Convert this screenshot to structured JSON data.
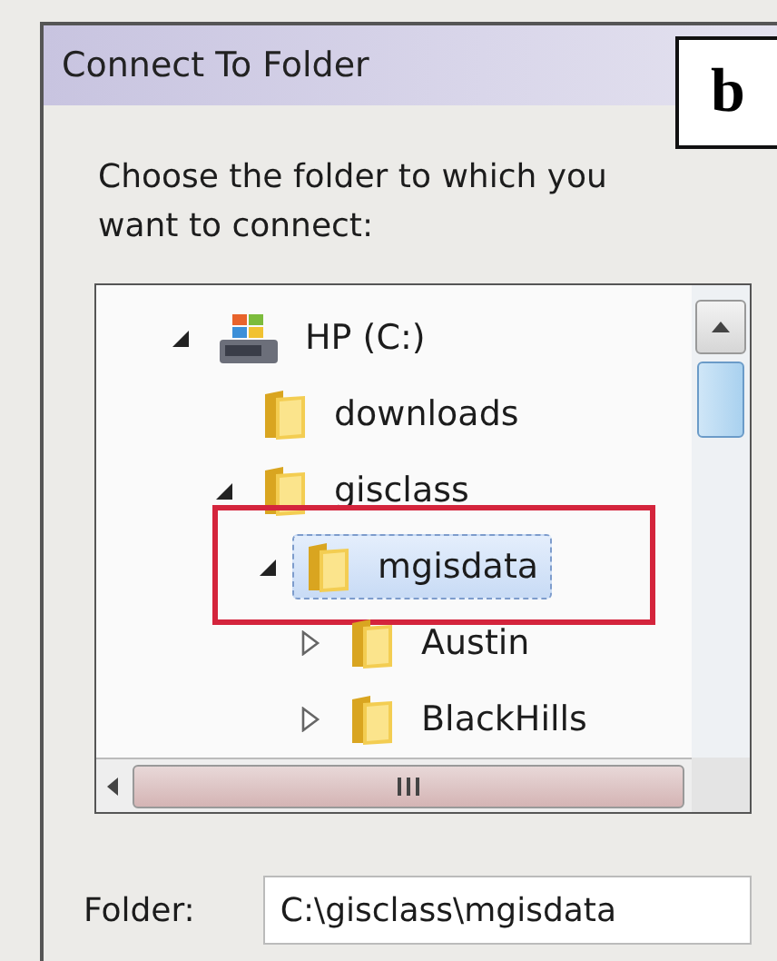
{
  "window": {
    "title": "Connect To Folder"
  },
  "figure_label": "b",
  "prompt": "Choose the folder to which you want to connect:",
  "tree": [
    {
      "label": "HP (C:)",
      "kind": "drive",
      "expandable": true,
      "expanded": true,
      "selected": false,
      "annotated": false,
      "children": [
        {
          "label": "downloads",
          "kind": "folder",
          "expandable": false,
          "selected": false,
          "annotated": false
        },
        {
          "label": "gisclass",
          "kind": "folder",
          "expandable": true,
          "expanded": true,
          "selected": false,
          "annotated": false,
          "children": [
            {
              "label": "mgisdata",
              "kind": "folder",
              "expandable": true,
              "expanded": true,
              "selected": true,
              "annotated": true,
              "children": [
                {
                  "label": "Austin",
                  "kind": "folder",
                  "expandable": true,
                  "expanded": false,
                  "selected": false,
                  "annotated": false
                },
                {
                  "label": "BlackHills",
                  "kind": "folder",
                  "expandable": true,
                  "expanded": false,
                  "selected": false,
                  "annotated": false
                }
              ]
            }
          ]
        }
      ]
    }
  ],
  "folder_field": {
    "label": "Folder:",
    "value": "C:\\gisclass\\mgisdata"
  }
}
